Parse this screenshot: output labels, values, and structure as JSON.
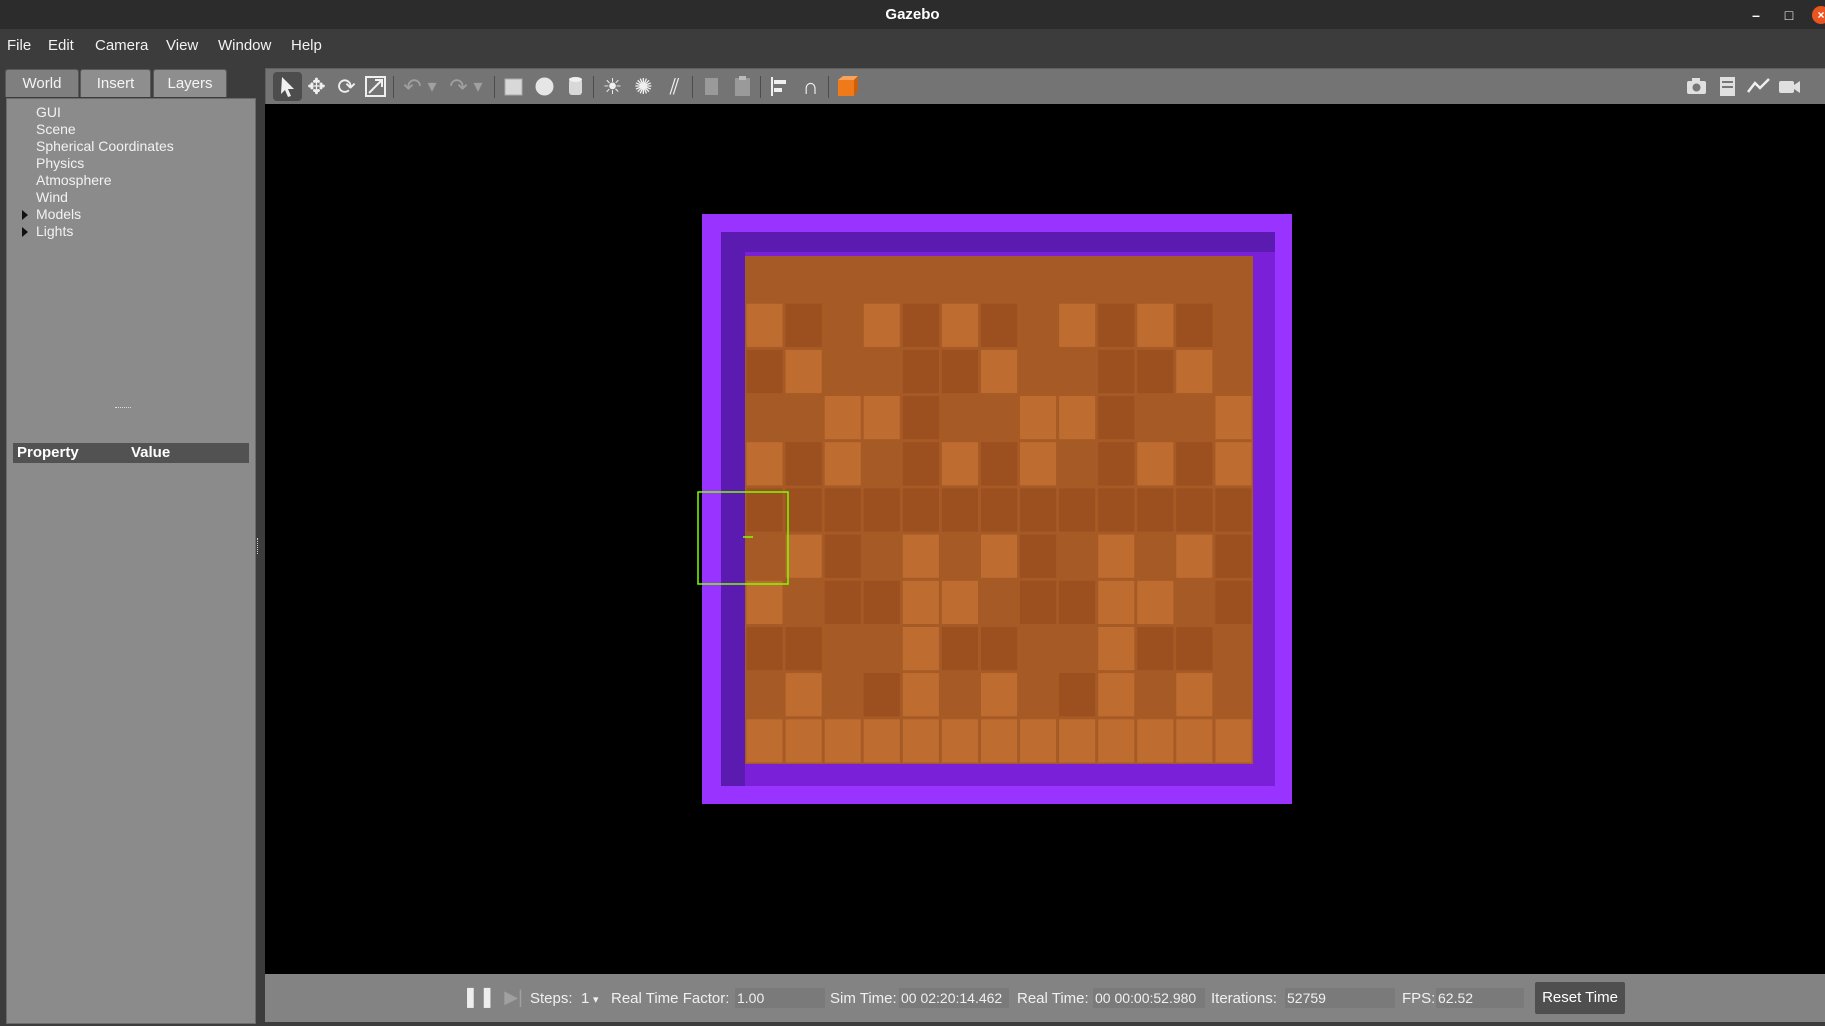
{
  "window": {
    "title": "Gazebo",
    "minimize": "–",
    "maximize": "□",
    "close": "×"
  },
  "menu": [
    "File",
    "Edit",
    "Camera",
    "View",
    "Window",
    "Help"
  ],
  "left_panel": {
    "tabs": [
      "World",
      "Insert",
      "Layers"
    ],
    "tree_items": [
      "GUI",
      "Scene",
      "Spherical Coordinates",
      "Physics",
      "Atmosphere",
      "Wind",
      "Models",
      "Lights"
    ],
    "property_header": {
      "property": "Property",
      "value": "Value"
    }
  },
  "toolbar": {
    "icons": [
      "select-icon",
      "translate-icon",
      "rotate-icon",
      "scale-icon",
      "undo-icon",
      "redo-icon",
      "box-icon",
      "sphere-icon",
      "cylinder-icon",
      "point-light-icon",
      "spot-light-icon",
      "directional-light-icon",
      "copy-icon",
      "paste-icon",
      "align-icon",
      "snap-icon",
      "change-view-icon",
      "screenshot-icon",
      "log-icon",
      "plot-icon",
      "record-video-icon"
    ]
  },
  "status": {
    "steps_label": "Steps:",
    "steps_value": "1",
    "rtf_label": "Real Time Factor:",
    "rtf_value": "1.00",
    "sim_time_label": "Sim Time:",
    "sim_time_value": "00 02:20:14.462",
    "real_time_label": "Real Time:",
    "real_time_value": "00 00:00:52.980",
    "iterations_label": "Iterations:",
    "iterations_value": "52759",
    "fps_label": "FPS:",
    "fps_value": "62.52",
    "reset_label": "Reset Time"
  },
  "scene": {
    "grid": "13x11",
    "colors": {
      "wall_outer": "#9933ff",
      "wall_inner": "#7a20d8",
      "wall_shadow": "#5b1bb0",
      "tile": "#a65a25",
      "tile_light": "#bf6c30",
      "tile_dark": "#9c4f1f",
      "bbox": "#7bff00"
    }
  }
}
